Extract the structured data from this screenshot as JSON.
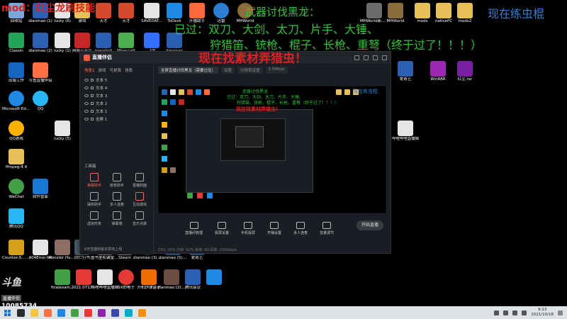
{
  "overlay": {
    "top_left": "mod：红尘龙刷技能",
    "weapon_title": "武器讨伐黑龙：",
    "passed_line1": "已过：双刀、大剑、太刀、片手、大锤、",
    "passed_line2": "狩猎笛、铳枪、棍子、长枪、重弩（终于过了！！！）",
    "material_hunt": "现在找素材弄猎虫！",
    "top_right": "现在练虫棍"
  },
  "desktop_icons": [
    {
      "id": "i1",
      "label": "回收站",
      "color": "#7aa7d8"
    },
    {
      "id": "i2",
      "label": "dianmao (1)",
      "color": "#2b5fb4"
    },
    {
      "id": "i3",
      "label": "dianmao (2)",
      "color": "#2b5fb4"
    },
    {
      "id": "i4",
      "label": "lucky (6)",
      "color": "#e5e5e5"
    },
    {
      "id": "i5",
      "label": "游戏",
      "color": "#e8c05a"
    },
    {
      "id": "i6",
      "label": "天才",
      "color": "#d24b2e"
    },
    {
      "id": "i7",
      "label": "SAVEDAT...",
      "color": "#e5e5e5"
    },
    {
      "id": "i8",
      "label": "ToDesk",
      "color": "#1e88e5"
    },
    {
      "id": "i9",
      "label": "开播助手",
      "color": "#ff6a3c"
    },
    {
      "id": "i10",
      "label": "迅雷",
      "color": "#2d7fd4"
    },
    {
      "id": "i11",
      "label": "MHWorld",
      "color": "#8a6b3a"
    },
    {
      "id": "i12",
      "label": "MHWorld新建文本",
      "color": "#6b6b6b"
    },
    {
      "id": "i13",
      "label": "mods",
      "color": "#e8c05a"
    },
    {
      "id": "i14",
      "label": "nativePC",
      "color": "#e8c05a"
    },
    {
      "id": "i15",
      "label": "mods2",
      "color": "#e8c05a"
    },
    {
      "id": "i16",
      "label": "Classin",
      "color": "#25a35a"
    },
    {
      "id": "i17",
      "label": "出版工作",
      "color": "#1565c0"
    },
    {
      "id": "i18",
      "label": "lucky (1)",
      "color": "#e5e5e5"
    },
    {
      "id": "i19",
      "label": "网易云音乐",
      "color": "#c62828"
    },
    {
      "id": "i20",
      "label": "maoshidi",
      "color": "#2b5fb4"
    },
    {
      "id": "i21",
      "label": "dianmao",
      "color": "#2b5fb4"
    },
    {
      "id": "i22",
      "label": "Minecraft",
      "color": "#4caf50"
    },
    {
      "id": "i23",
      "label": "飞书",
      "color": "#3370ff"
    },
    {
      "id": "i24",
      "label": "WinRAR",
      "color": "#9c27b0"
    },
    {
      "id": "i25",
      "label": "红尘.rar",
      "color": "#7b1fa2"
    },
    {
      "id": "i26",
      "label": "Microsoft Edge",
      "color": "#1e88e5"
    },
    {
      "id": "i27",
      "label": "斗鱼直播伴侣",
      "color": "#ff7043"
    },
    {
      "id": "i28",
      "label": "QQ",
      "color": "#29b6f6"
    },
    {
      "id": "i29",
      "label": "QQ游戏",
      "color": "#ffb300"
    },
    {
      "id": "i30",
      "label": "ffmpeg-4.4",
      "color": "#e8c05a"
    },
    {
      "id": "i31",
      "label": "WeChat",
      "color": "#43a047"
    },
    {
      "id": "i32",
      "label": "软件管家",
      "color": "#1976d2"
    },
    {
      "id": "i33",
      "label": "腾讯QQ",
      "color": "#29b6f6"
    },
    {
      "id": "i34",
      "label": "Counter-S... Global Off...",
      "color": "#d4a017"
    },
    {
      "id": "i35",
      "label": "404Error.txt",
      "color": "#e5e5e5"
    },
    {
      "id": "i36",
      "label": "Monster Hunter...",
      "color": "#8d6e63"
    },
    {
      "id": "i37",
      "label": "同仁行书",
      "color": "#455a64"
    },
    {
      "id": "i38",
      "label": "lucky (5)",
      "color": "#e5e5e5"
    },
    {
      "id": "i39",
      "label": "图书室和课堂_0.jpg",
      "color": "#a1887f"
    },
    {
      "id": "i40",
      "label": "Steam",
      "color": "#37474f"
    },
    {
      "id": "i41",
      "label": "dianmao (3).jpg",
      "color": "#2b5fb4"
    },
    {
      "id": "i42",
      "label": "dianmao (5).docx",
      "color": "#2b5fb4"
    },
    {
      "id": "i43",
      "label": "爱奇艺",
      "color": "#43a047"
    },
    {
      "id": "i44",
      "label": "finalexam...",
      "color": "#e53935"
    },
    {
      "id": "i45",
      "label": "2021.0713...",
      "color": "#e5e5e5"
    },
    {
      "id": "i46",
      "label": "哔哩哔哩直播姬",
      "color": "#e53935"
    },
    {
      "id": "i47",
      "label": "SX的电子",
      "color": "#ef6c00"
    },
    {
      "id": "i48",
      "label": "开机炸弹盒子",
      "color": "#6d4c41"
    },
    {
      "id": "i49",
      "label": "dianmao (2).docx",
      "color": "#2b5fb4"
    },
    {
      "id": "i50",
      "label": "腾讯会议",
      "color": "#1e88e5"
    }
  ],
  "app": {
    "scene_tabs": [
      "场景1",
      "游戏",
      "可是我",
      "场景"
    ],
    "sources": [
      "文本 5",
      "文本 4",
      "文本 3",
      "文本 2",
      "文本 1",
      "全屏 1"
    ],
    "toolbox_title": "工具箱",
    "tools": [
      "弹幕助手",
      "房管助手",
      "直播封面",
      "抽奖助手",
      "多人连麦",
      "互动游戏",
      "虚拟形象",
      "弹幕墙",
      "音乐点歌"
    ],
    "left_footer": "K开直播新版本即将上线",
    "main_tabs": [
      "全屏直播讨伐黑龙（需要过往）",
      "设置",
      "分辨率设置",
      "2.5Mbps"
    ],
    "preview_text": {
      "green1": "武器讨伐黑龙",
      "green2": "已过：双刀、大剑、太刀、片手、大锤、",
      "green3": "狩猎笛、铳枪、棍子、长枪、重弩（终于过了！！！）",
      "red": "现在找素材弄猎虫！",
      "blue": "现在练虫棍"
    },
    "bottom_actions": [
      "直播间管理",
      "投屏设置",
      "手机投屏",
      "开播设置",
      "多人连麦",
      "音量调节"
    ],
    "go_live": "开始直播",
    "status": "CPU: 15%  内存: 62%  帧率: 60  码率: 2500kbps"
  },
  "watermark": {
    "logo": "斗鱼",
    "sub": "直播伴侣",
    "room_id": "10085734"
  },
  "taskbar": {
    "time": "9:13",
    "date": "2021/10/18",
    "task_icon_colors": [
      "#2b2b2b",
      "#f5c542",
      "#ff7043",
      "#1e88e5",
      "#43a047",
      "#e53935",
      "#8e24aa",
      "#3949ab",
      "#00acc1",
      "#fb8c00"
    ]
  }
}
